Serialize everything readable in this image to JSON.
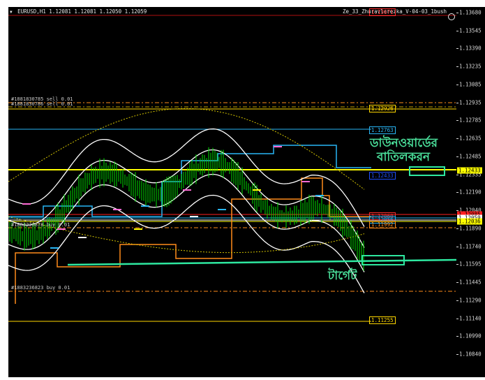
{
  "title": {
    "symbol": "EURUSD,H1",
    "ohlc": "1.12081 1.12081 1.12050 1.12059"
  },
  "expert": {
    "name": "Ze_33_Zhuravlerezka_V-04-03_1bush"
  },
  "price_axis": {
    "ticks": [
      "1.13680",
      "1.13545",
      "1.13390",
      "1.13235",
      "1.13085",
      "1.12935",
      "1.12785",
      "1.12635",
      "1.12485",
      "1.12335",
      "1.12190",
      "1.12040",
      "1.11890",
      "1.11740",
      "1.11595",
      "1.11445",
      "1.11290",
      "1.11140",
      "1.10990",
      "1.10840"
    ],
    "current_labels": [
      {
        "text": "1.12085",
        "color": "#ff2020"
      },
      {
        "text": "1.12059",
        "color": "#ffffff"
      },
      {
        "text": "1.12036",
        "color": "#ffff00"
      }
    ],
    "level_label": {
      "text": "1.12433",
      "color": "#ffff00"
    }
  },
  "chart_labels": {
    "top_red": "1.13671",
    "gold_upper": "1.12926",
    "cyan_upper": "1.12763",
    "blue_level": "1.12433",
    "red_mid": "1.12060",
    "cyan_mid": "1.12056",
    "orange_mid": "1.11992",
    "gold_lower": "1.11255",
    "order_1": "#1881830785 sell 0.01",
    "order_2": "#1881830786 sell 0.01",
    "order_3": "#1883236878 buy 0.01",
    "order_4": "#1883236823 buy 0.01"
  },
  "annotations": {
    "cancel_line1": "ডাউনওয়ার্ডের",
    "cancel_line2": "বাতিলকরন",
    "target": "টার্গেট"
  },
  "colors": {
    "candles": "#00e000",
    "bands": "#ffffff",
    "cyan_level": "#29b6f6",
    "orange_level": "#ff8c1a",
    "gold_level": "#ffd700",
    "annotation": "#4adf9a"
  }
}
